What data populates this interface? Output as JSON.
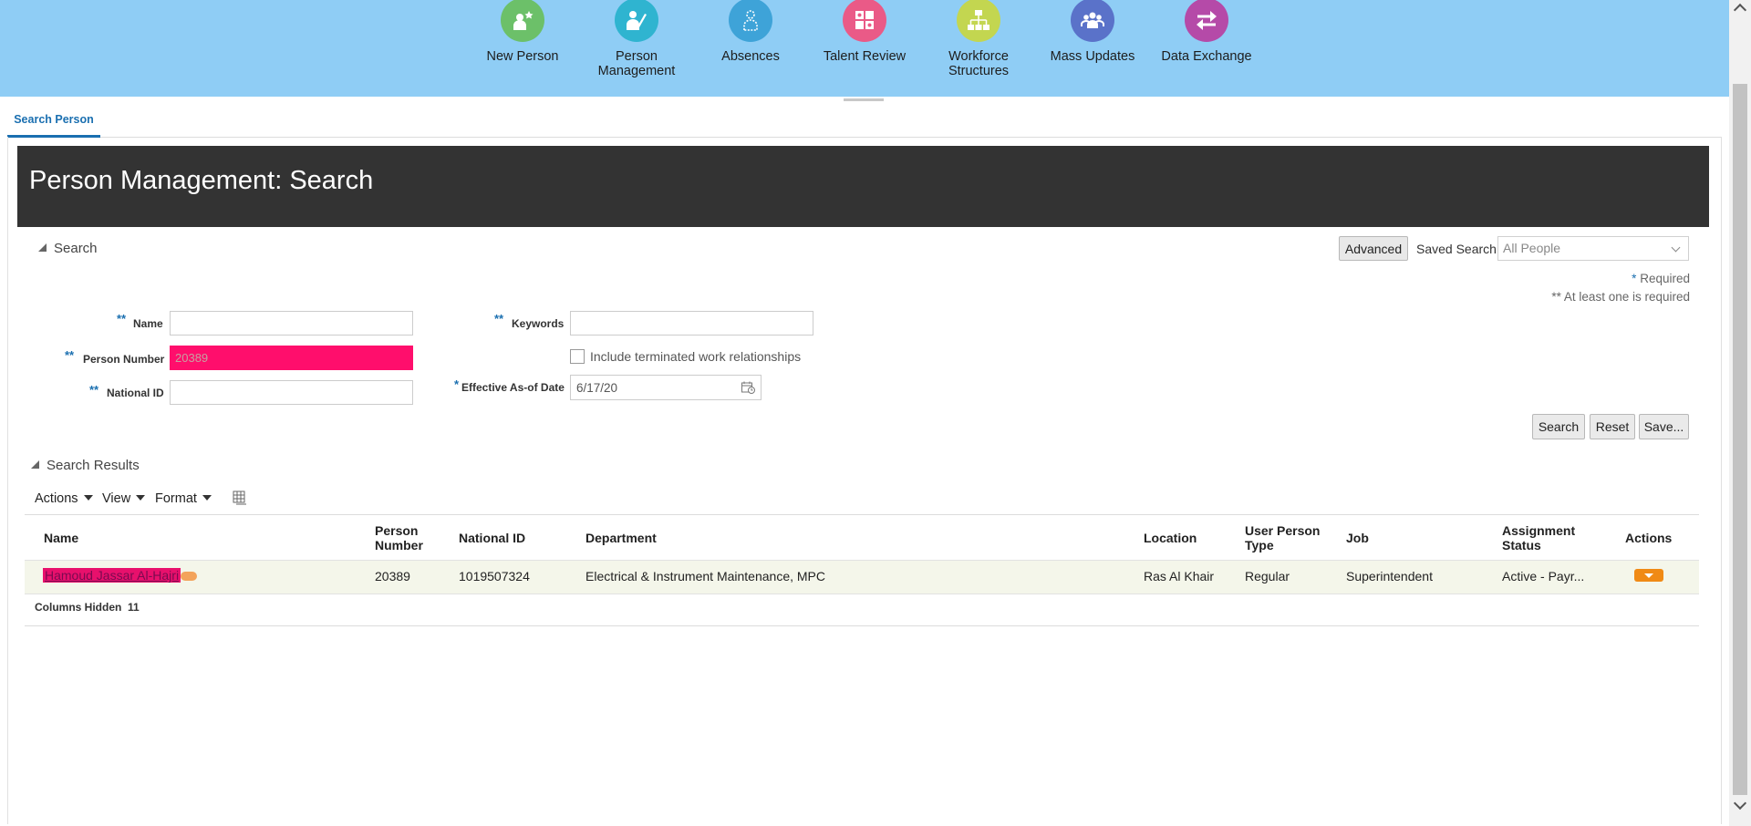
{
  "springboard": {
    "items": [
      {
        "label": "New Person",
        "color": "#6cc069",
        "icon": "new-person-icon"
      },
      {
        "label": "Person\nManagement",
        "color": "#2fb4d0",
        "icon": "person-management-icon"
      },
      {
        "label": "Absences",
        "color": "#3ea3d8",
        "icon": "absences-icon"
      },
      {
        "label": "Talent Review",
        "color": "#ea5a87",
        "icon": "talent-review-icon"
      },
      {
        "label": "Workforce\nStructures",
        "color": "#c3d650",
        "icon": "workforce-structures-icon"
      },
      {
        "label": "Mass Updates",
        "color": "#5a72c9",
        "icon": "mass-updates-icon"
      },
      {
        "label": "Data Exchange",
        "color": "#b54aa8",
        "icon": "data-exchange-icon"
      }
    ]
  },
  "tabs": [
    {
      "label": "Search Person"
    }
  ],
  "page": {
    "title": "Person Management: Search"
  },
  "search": {
    "section_label": "Search",
    "advanced_label": "Advanced",
    "saved_search_label": "Saved Search",
    "saved_search_value": "All People",
    "required_note": "Required",
    "at_least_one_note": "** At least one is required",
    "fields": {
      "name_label": "Name",
      "name_value": "",
      "person_number_label": "Person Number",
      "person_number_value": "20389",
      "national_id_label": "National ID",
      "national_id_value": "",
      "keywords_label": "Keywords",
      "keywords_value": "",
      "include_terminated_label": "Include terminated work relationships",
      "effective_date_label": "Effective As-of Date",
      "effective_date_value": "6/17/20"
    },
    "buttons": {
      "search": "Search",
      "reset": "Reset",
      "save": "Save..."
    }
  },
  "results": {
    "section_label": "Search Results",
    "menu": {
      "actions": "Actions",
      "view": "View",
      "format": "Format"
    },
    "columns": {
      "name": "Name",
      "person_number": "Person\nNumber",
      "national_id": "National ID",
      "department": "Department",
      "location": "Location",
      "user_person_type": "User Person\nType",
      "job": "Job",
      "assignment_status": "Assignment\nStatus",
      "actions": "Actions"
    },
    "rows": [
      {
        "name": "Hamoud Jassar Al-Hajri",
        "person_number": "20389",
        "national_id": "1019507324",
        "department": "Electrical & Instrument Maintenance, MPC",
        "location": "Ras Al Khair",
        "user_person_type": "Regular",
        "job": "Superintendent",
        "assignment_status": "Active - Payr..."
      }
    ],
    "columns_hidden_label": "Columns Hidden",
    "columns_hidden_count": "11"
  },
  "colors": {
    "springboard_bg": "#8fcdf5",
    "header_bg": "#333333",
    "highlight": "#ff0e6c",
    "accent": "#1a6fb0",
    "actions_orange": "#f08a15"
  }
}
